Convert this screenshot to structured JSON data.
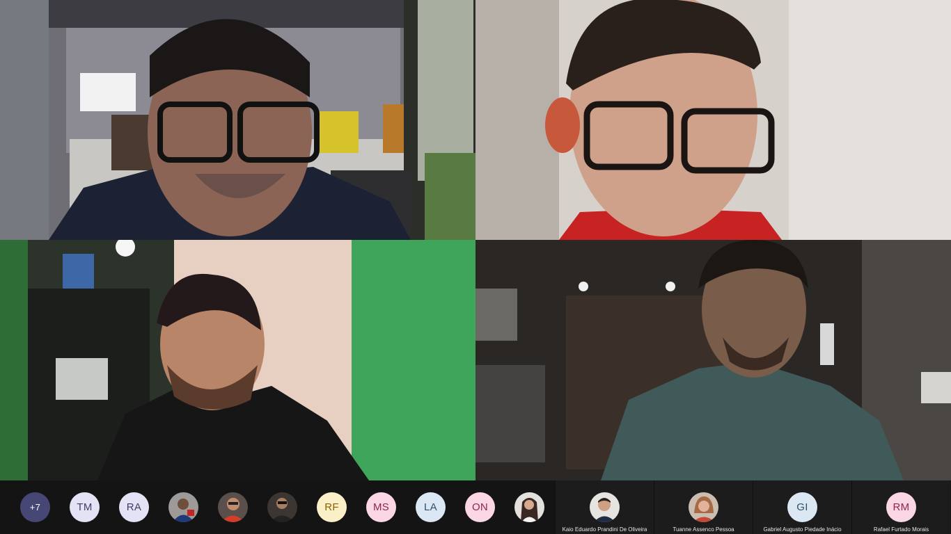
{
  "roster": {
    "overflow_label": "+7",
    "items": [
      {
        "initials": "TM"
      },
      {
        "initials": "RA"
      },
      {
        "initials": "",
        "icon": "photo-avatar"
      },
      {
        "initials": "",
        "icon": "photo-avatar"
      },
      {
        "initials": "",
        "icon": "photo-avatar"
      },
      {
        "initials": "RF"
      },
      {
        "initials": "MS"
      },
      {
        "initials": "LA"
      },
      {
        "initials": "ON"
      },
      {
        "initials": "",
        "icon": "photo-avatar"
      }
    ]
  },
  "named_participants": [
    {
      "name": "Kaio Eduardo Prandini De Oliveira",
      "initials": ""
    },
    {
      "name": "Tuanne Assenco Pessoa",
      "initials": ""
    },
    {
      "name": "Gabriel Augusto Piedade Inácio",
      "initials": "GI"
    },
    {
      "name": "Rafael Furtado Morais",
      "initials": "RM"
    }
  ],
  "colors": {
    "overflow": "#464775",
    "strip_background": "#141414"
  }
}
